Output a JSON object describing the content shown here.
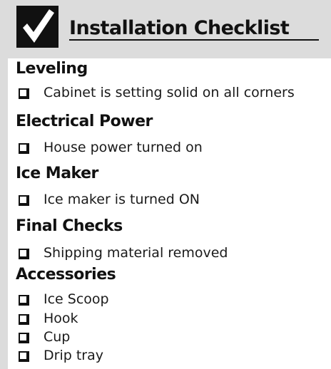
{
  "header": {
    "title": "Installation Checklist",
    "icon": "checkmark-icon"
  },
  "sections": [
    {
      "title": "Leveling",
      "items": [
        "Cabinet is setting solid on all corners"
      ]
    },
    {
      "title": "Electrical Power",
      "items": [
        "House power turned on"
      ]
    },
    {
      "title": "Ice Maker",
      "items": [
        "Ice maker is turned ON"
      ]
    },
    {
      "title": "Final Checks",
      "items": [
        "Shipping material removed"
      ]
    },
    {
      "title": "Accessories",
      "items": [
        "Ice Scoop",
        "Hook",
        "Cup",
        "Drip tray"
      ]
    }
  ],
  "colors": {
    "header_background": "#dcdcdc",
    "text": "#111111"
  }
}
